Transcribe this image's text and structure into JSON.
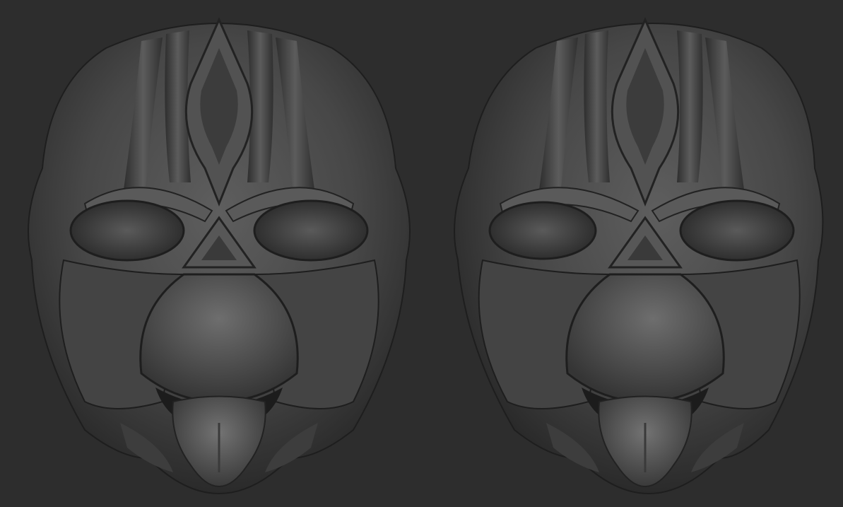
{
  "scene": {
    "background_color": "#2d2d2d",
    "model_base_color": "#4a4a4a",
    "model_highlight_color": "#7a7a7a",
    "model_shadow_color": "#1c1c1c",
    "models": [
      {
        "id": "mask-front-view",
        "description_icon": "sculpted-mask-icon"
      },
      {
        "id": "mask-angled-view",
        "description_icon": "sculpted-mask-icon"
      }
    ]
  }
}
